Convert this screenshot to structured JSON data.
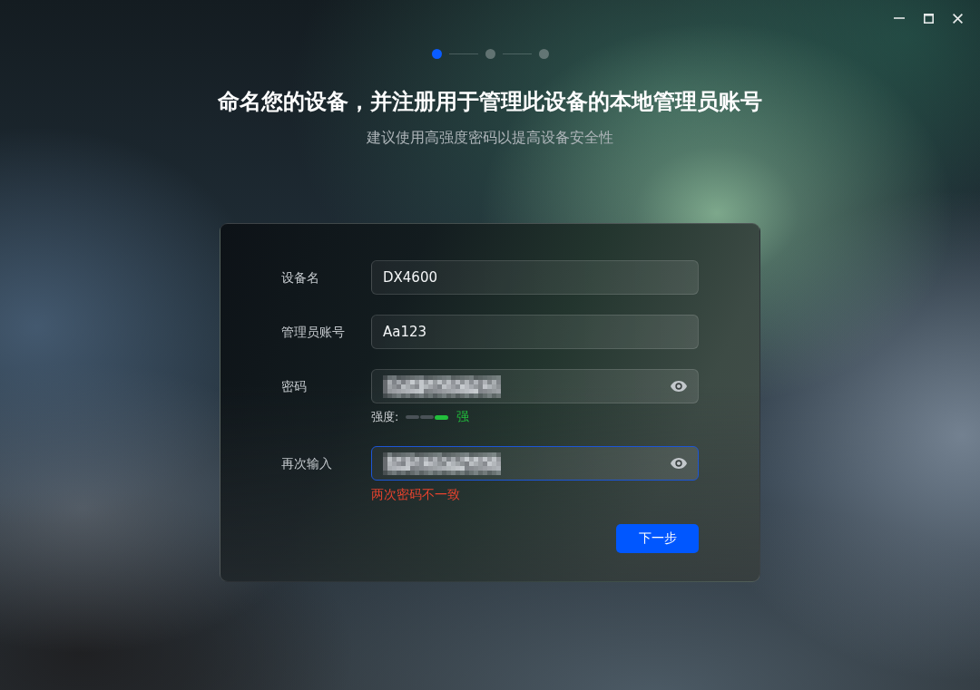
{
  "steps": [
    {
      "selected": true
    },
    {
      "selected": false
    },
    {
      "selected": false
    }
  ],
  "header": {
    "title": "命名您的设备，并注册用于管理此设备的本地管理员账号",
    "subtitle": "建议使用高强度密码以提高设备安全性"
  },
  "form": {
    "fields": [
      {
        "kind": "text",
        "label": "设备名",
        "value": "DX4600",
        "focused": false
      },
      {
        "kind": "text",
        "label": "管理员账号",
        "value": "Aa123",
        "focused": false
      },
      {
        "kind": "password",
        "label": "密码",
        "redacted": true,
        "focused": false,
        "strength": {
          "label": "强度:",
          "level": 1,
          "reading": "强"
        }
      },
      {
        "kind": "password",
        "label": "再次输入",
        "redacted": true,
        "focused": true,
        "error": "两次密码不一致"
      }
    ],
    "next_button": "下一步"
  }
}
